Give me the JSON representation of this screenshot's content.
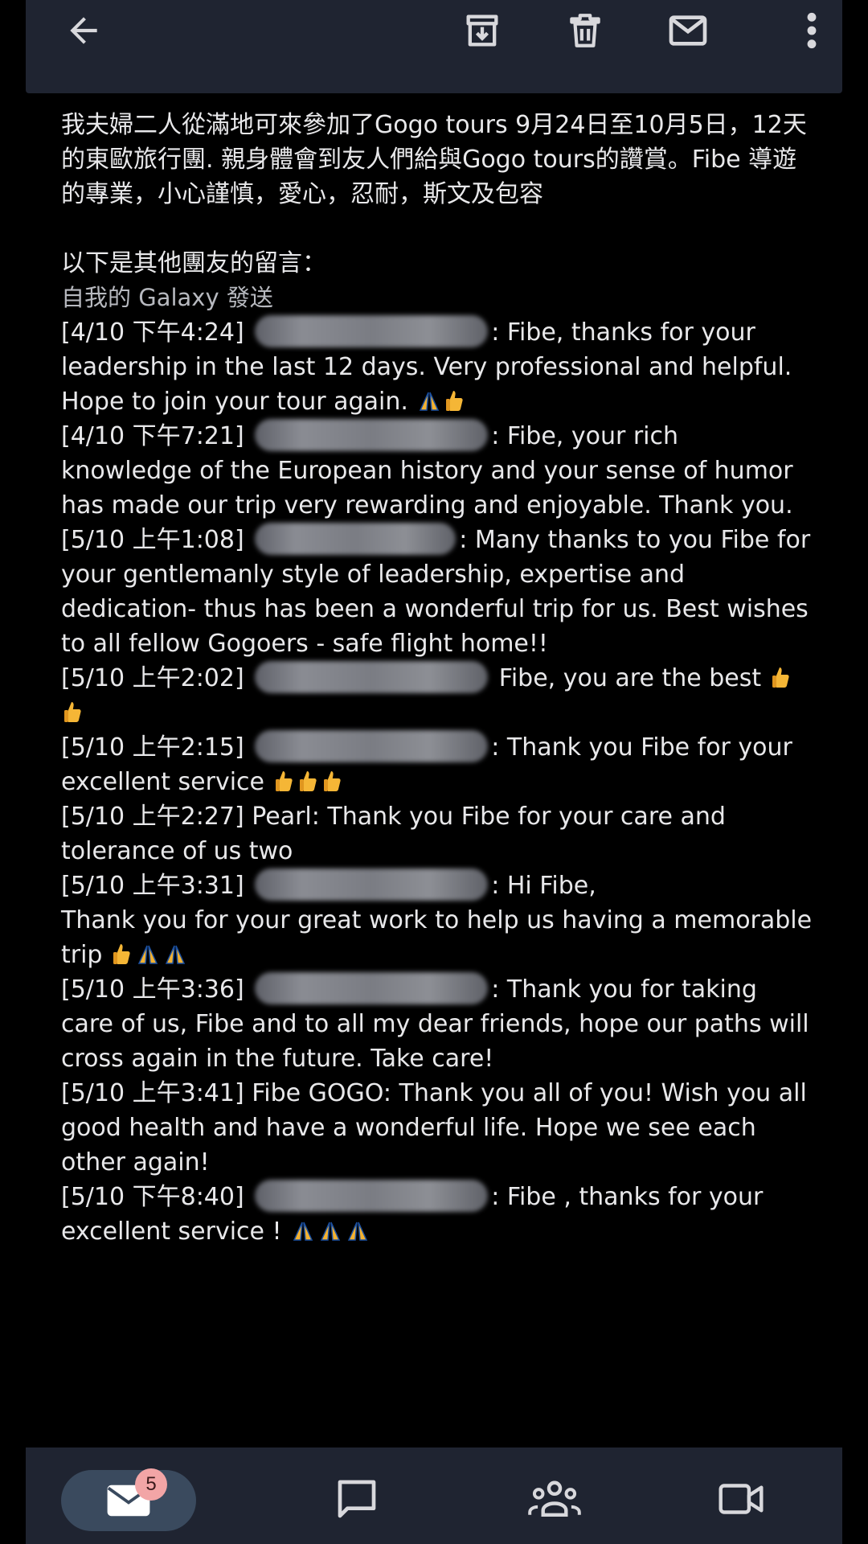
{
  "toolbar": {
    "back": "back-icon",
    "archive": "archive-icon",
    "delete": "delete-icon",
    "mark_unread": "mail-icon",
    "more": "more-vert-icon"
  },
  "email": {
    "intro": "我夫婦二人從滿地可來參加了Gogo tours 9月24日至10月5日，12天的東歐旅行團. 親身體會到友人們給與Gogo tours的讚賞。Fibe 導遊的專業，小心謹慎，愛心，忍耐，斯文及包容",
    "others_heading": "以下是其他團友的留言：",
    "sent_from": "自我的 Galaxy 發送",
    "messages": [
      {
        "time": "[4/10 下午4:24]",
        "sender": "",
        "text": ": Fibe, thanks for your leadership in the last 12 days. Very professional and helpful. Hope to join your tour again.",
        "emoji": "🙏👍"
      },
      {
        "time": "[4/10 下午7:21]",
        "sender": "",
        "text": ": Fibe, your rich knowledge of the European history and your sense of humor has made our trip very rewarding and enjoyable. Thank you.",
        "emoji": ""
      },
      {
        "time": "[5/10 上午1:08]",
        "sender": "",
        "text": ": Many thanks to you Fibe for your gentlemanly style of leadership, expertise and dedication- thus has been a wonderful trip for us. Best wishes to all fellow Gogoers - safe flight home!!",
        "emoji": ""
      },
      {
        "time": "[5/10 上午2:02]",
        "sender": "",
        "text": " Fibe, you are the best",
        "emoji": "👍👍"
      },
      {
        "time": "[5/10 上午2:15]",
        "sender": "",
        "text": ": Thank you Fibe for your excellent service",
        "emoji": "👍👍👍"
      },
      {
        "time": "[5/10 上午2:27]",
        "sender": "Pearl",
        "text": ": Thank you Fibe for  your  care and tolerance of us two",
        "emoji": ""
      },
      {
        "time": "[5/10 上午3:31]",
        "sender": "",
        "text": ": Hi Fibe,",
        "text2": "Thank you for your great work to help us having a memorable trip",
        "emoji": "👍🙏🙏"
      },
      {
        "time": "[5/10 上午3:36]",
        "sender": "",
        "text": ": Thank you for taking care of us, Fibe and to all my dear friends, hope our paths will cross again in the future. Take care!",
        "emoji": ""
      },
      {
        "time": "[5/10 上午3:41]",
        "sender": "Fibe GOGO",
        "text": ": Thank you all of you! Wish you all good health and have a wonderful life. Hope we see each other again!",
        "emoji": ""
      },
      {
        "time": "[5/10 下午8:40]",
        "sender": "",
        "text": ": Fibe , thanks for your excellent service !",
        "emoji": "🙏🙏🙏"
      }
    ]
  },
  "bottom_nav": {
    "mail_badge": "5",
    "mail": "mail-icon",
    "chat": "chat-icon",
    "spaces": "group-icon",
    "meet": "video-icon"
  },
  "colors": {
    "bar_bg": "#1f2431",
    "page_bg": "#000000",
    "text": "#e8e8ea",
    "badge": "#f2a5a6"
  }
}
